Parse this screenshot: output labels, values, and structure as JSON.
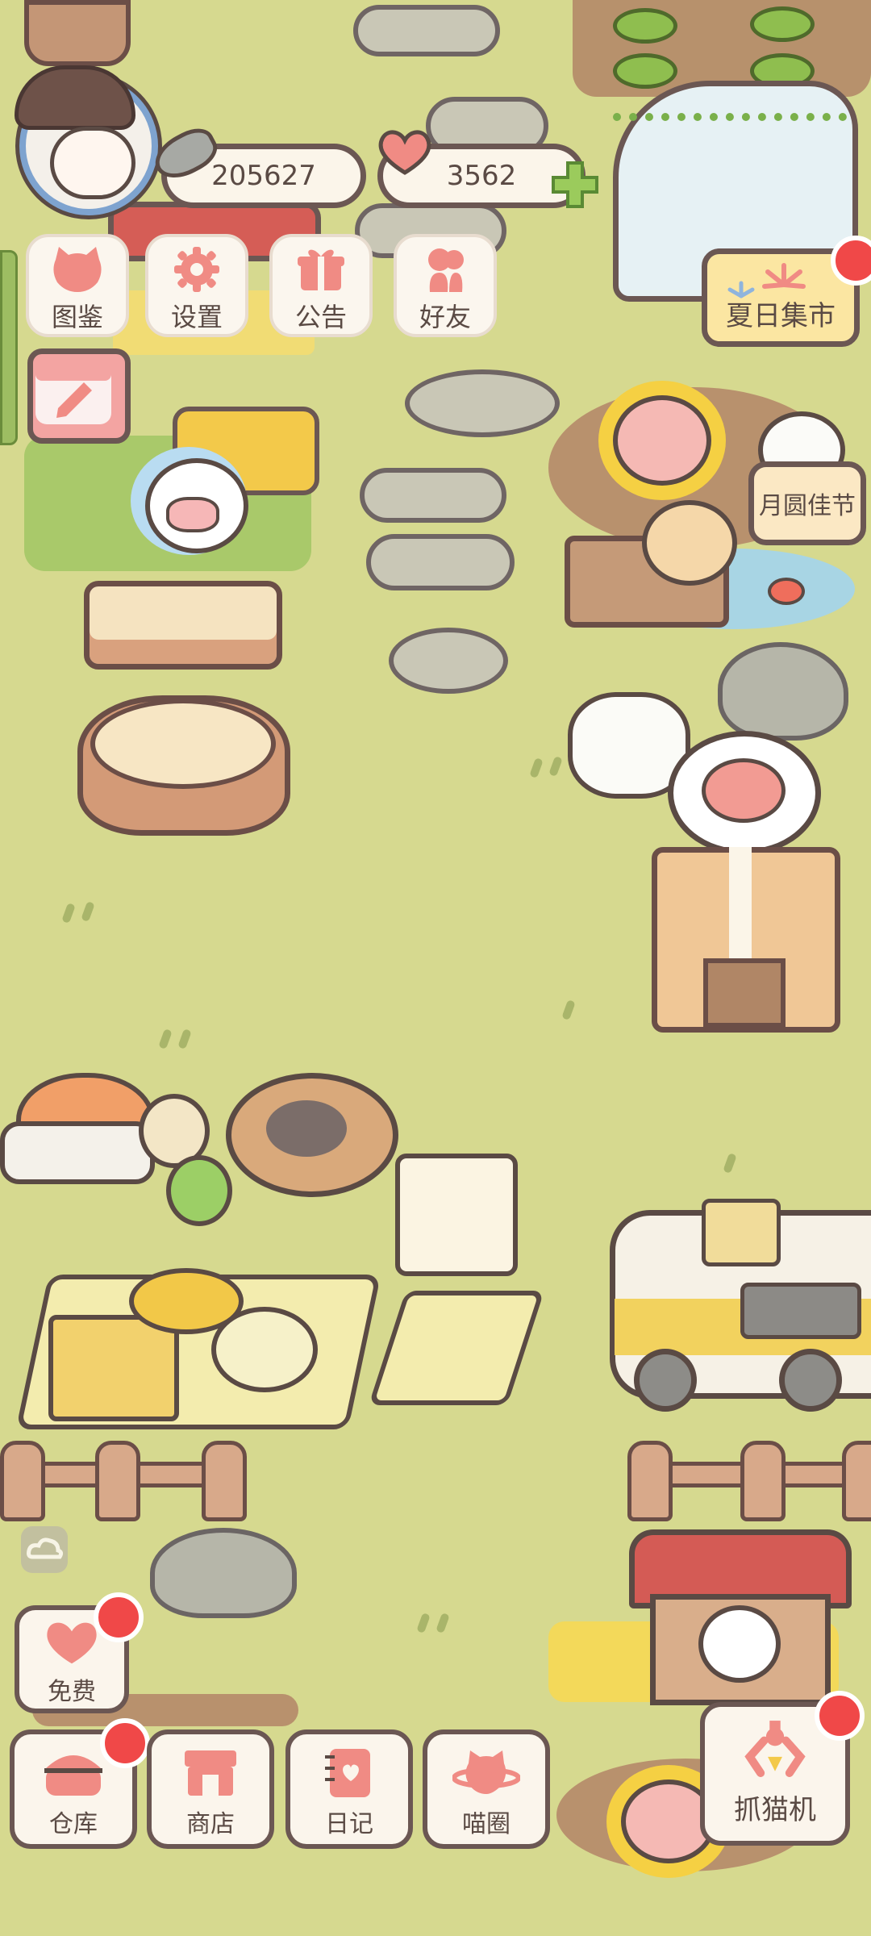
{
  "currency": {
    "fish": "205627",
    "hearts": "3562"
  },
  "menu": {
    "atlas": "图鉴",
    "settings": "设置",
    "notice": "公告",
    "friends": "好友"
  },
  "events": {
    "summer_market": "夏日集市",
    "mid_autumn": "月圆佳节"
  },
  "bottom": {
    "free": "免费",
    "warehouse": "仓库",
    "shop": "商店",
    "diary": "日记",
    "circle": "喵圈",
    "claw": "抓猫机"
  },
  "colors": {
    "grass": "#d6d98f",
    "accent_pink": "#f08b84",
    "badge_red": "#f04848",
    "border": "#6b5753"
  },
  "icons": {
    "atlas": "cat-head-icon",
    "settings": "gear-icon",
    "notice": "gift-icon",
    "friends": "friends-icon",
    "free": "heart-icon",
    "warehouse": "basket-icon",
    "shop": "shop-icon",
    "diary": "diary-icon",
    "circle": "planet-cat-icon",
    "claw": "claw-icon"
  }
}
